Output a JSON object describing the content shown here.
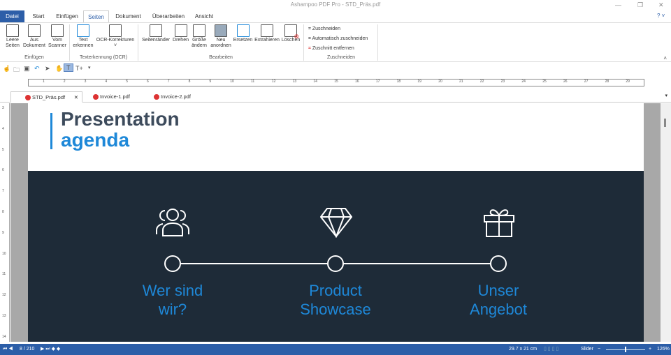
{
  "window": {
    "title": "Ashampoo PDF Pro - STD_Präs.pdf"
  },
  "tabs": [
    "Datei",
    "Start",
    "Einfügen",
    "Seiten",
    "Dokument",
    "Überarbeiten",
    "Ansicht"
  ],
  "ribbon": {
    "insert": [
      {
        "l1": "Leere",
        "l2": "Seiten"
      },
      {
        "l1": "Aus",
        "l2": "Dokument"
      },
      {
        "l1": "Vom",
        "l2": "Scanner"
      }
    ],
    "insert_group": "Einfügen",
    "ocr": [
      {
        "l1": "Text",
        "l2": "erkennen"
      },
      {
        "l1": "OCR-Korrekturen",
        "l2": "˅"
      }
    ],
    "ocr_group": "Texterkennung (OCR)",
    "edit": [
      {
        "l1": "Seitenränder",
        "l2": ""
      },
      {
        "l1": "Drehen",
        "l2": ""
      },
      {
        "l1": "Größe",
        "l2": "ändern"
      },
      {
        "l1": "Neu",
        "l2": "anordnen"
      },
      {
        "l1": "Ersetzen",
        "l2": ""
      },
      {
        "l1": "Extrahieren",
        "l2": ""
      },
      {
        "l1": "Löschen",
        "l2": ""
      }
    ],
    "edit_group": "Bearbeiten",
    "crop": [
      "Zuschneiden",
      "Automatisch zuschneiden",
      "Zuschnitt entfernen"
    ],
    "crop_group": "Zuschneiden"
  },
  "ruler": [
    "1",
    "2",
    "3",
    "4",
    "5",
    "6",
    "7",
    "8",
    "9",
    "10",
    "11",
    "12",
    "13",
    "14",
    "15",
    "16",
    "17",
    "18",
    "19",
    "20",
    "21",
    "22",
    "23",
    "24",
    "25",
    "26",
    "27",
    "28",
    "29"
  ],
  "vruler": [
    "3",
    "4",
    "5",
    "6",
    "7",
    "8",
    "9",
    "10",
    "11",
    "12",
    "13",
    "14"
  ],
  "doc_tabs": [
    "STD_Präs.pdf",
    "Invoice-1.pdf",
    "Invoice-2.pdf"
  ],
  "slide": {
    "title1": "Presentation",
    "title2": "agenda",
    "items": [
      {
        "l1": "Wer sind",
        "l2": "wir?"
      },
      {
        "l1": "Product",
        "l2": "Showcase"
      },
      {
        "l1": "Unser",
        "l2": "Angebot"
      }
    ]
  },
  "status": {
    "page": "8 / 210",
    "size": "29.7 x 21 cm",
    "slider": "Slider",
    "zoom": "126%"
  }
}
